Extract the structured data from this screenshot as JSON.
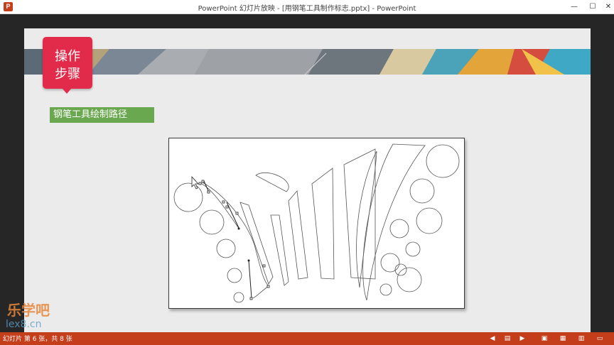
{
  "window": {
    "title": "PowerPoint 幻灯片放映 - [用钢笔工具制作标志.pptx] - PowerPoint",
    "app_icon": "P"
  },
  "slide": {
    "tag_line1": "操作",
    "tag_line2": "步骤",
    "section_label": "钢笔工具绘制路径"
  },
  "watermark": {
    "line1": "乐学吧",
    "line2": "lex8.cn"
  },
  "statusbar": {
    "slide_info": "幻灯片 第 6 张，共 8 张"
  },
  "colors": {
    "accent_red": "#e22a4a",
    "section_green": "#6aa84f",
    "statusbar": "#c43e1c"
  },
  "icons": [
    "previous-icon",
    "slide-menu-icon",
    "next-icon",
    "normal-view-icon",
    "slide-sorter-icon",
    "reading-view-icon",
    "slideshow-icon"
  ]
}
